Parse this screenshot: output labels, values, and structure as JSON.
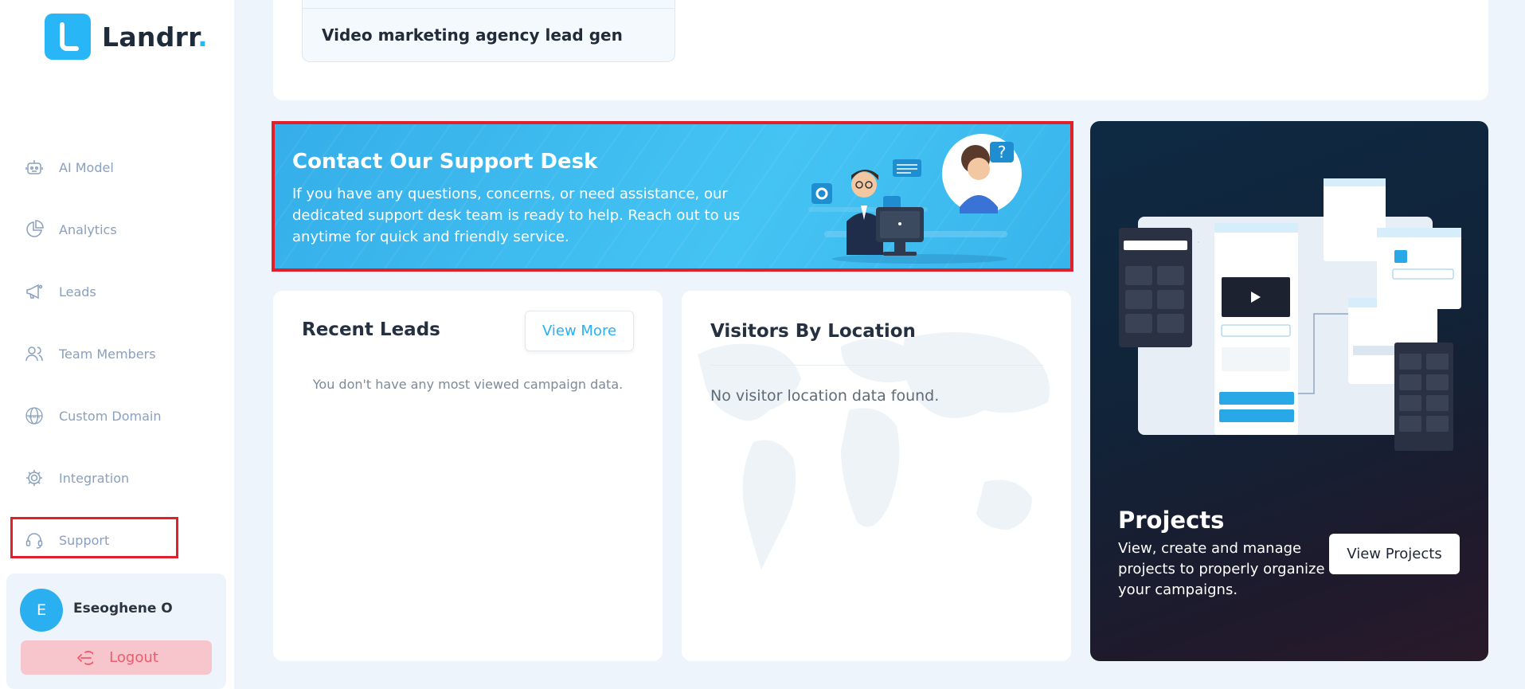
{
  "brand": {
    "name": "Landrr",
    "dot": ".",
    "accent": "#29b6f6"
  },
  "sidebar": {
    "items": [
      {
        "label": "AI Model",
        "icon": "robot-icon"
      },
      {
        "label": "Analytics",
        "icon": "pie-chart-icon"
      },
      {
        "label": "Leads",
        "icon": "megaphone-icon"
      },
      {
        "label": "Team Members",
        "icon": "users-icon"
      },
      {
        "label": "Custom Domain",
        "icon": "globe-www-icon"
      },
      {
        "label": "Integration",
        "icon": "gear-icon"
      },
      {
        "label": "Support",
        "icon": "headset-icon"
      }
    ],
    "user": {
      "initial": "E",
      "name": "Eseoghene O"
    },
    "logout_label": "Logout"
  },
  "top_card": {
    "campaign_title": "Video marketing agency lead gen"
  },
  "support_banner": {
    "title": "Contact Our Support Desk",
    "text": "If you have any questions, concerns, or need assistance, our dedicated support desk team is ready to help. Reach out to us anytime for quick and friendly service."
  },
  "recent_leads": {
    "title": "Recent Leads",
    "view_more_label": "View More",
    "empty_text": "You don't have any most viewed campaign data."
  },
  "visitors": {
    "title": "Visitors By Location",
    "empty_text": "No visitor location data found."
  },
  "projects": {
    "title": "Projects",
    "text": "View, create and manage projects to properly organize your campaigns.",
    "button_label": "View Projects"
  },
  "colors": {
    "highlight_border": "#e0202b",
    "logout_bg": "#f7c6cd",
    "logout_text": "#ef5b6c"
  }
}
